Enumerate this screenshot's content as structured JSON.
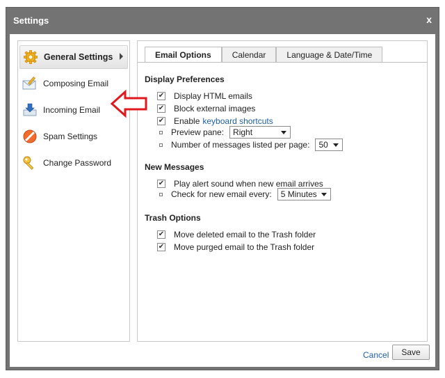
{
  "dialog": {
    "title": "Settings",
    "close_label": "x"
  },
  "sidebar": {
    "items": [
      {
        "label": "General Settings",
        "icon": "gear-icon",
        "active": true
      },
      {
        "label": "Composing Email",
        "icon": "envelope-pencil-icon"
      },
      {
        "label": "Incoming Email",
        "icon": "inbox-download-icon"
      },
      {
        "label": "Spam Settings",
        "icon": "no-entry-icon"
      },
      {
        "label": "Change Password",
        "icon": "key-icon"
      }
    ]
  },
  "tabs": [
    {
      "label": "Email Options",
      "active": true
    },
    {
      "label": "Calendar"
    },
    {
      "label": "Language & Date/Time"
    }
  ],
  "display_preferences": {
    "title": "Display Preferences",
    "display_html": {
      "label": "Display HTML emails",
      "checked": true
    },
    "block_images": {
      "label": "Block external images",
      "checked": true
    },
    "enable_shortcuts": {
      "label": "Enable",
      "link": "keyboard shortcuts",
      "checked": true
    },
    "preview_pane": {
      "label": "Preview pane:",
      "value": "Right"
    },
    "messages_per_page": {
      "label": "Number of messages listed per page:",
      "value": "50"
    }
  },
  "new_messages": {
    "title": "New Messages",
    "alert_sound": {
      "label": "Play alert sound when new email arrives",
      "checked": true
    },
    "check_every": {
      "label": "Check for new email every:",
      "value": "5 Minutes"
    }
  },
  "trash_options": {
    "title": "Trash Options",
    "move_deleted": {
      "label": "Move deleted email to the Trash folder",
      "checked": true
    },
    "move_purged": {
      "label": "Move purged email to the Trash folder",
      "checked": true
    }
  },
  "footer": {
    "cancel_label": "Cancel",
    "save_label": "Save"
  },
  "colors": {
    "titlebar": "#737373",
    "link": "#1f5fa6",
    "annotation_arrow": "#e0181f"
  }
}
